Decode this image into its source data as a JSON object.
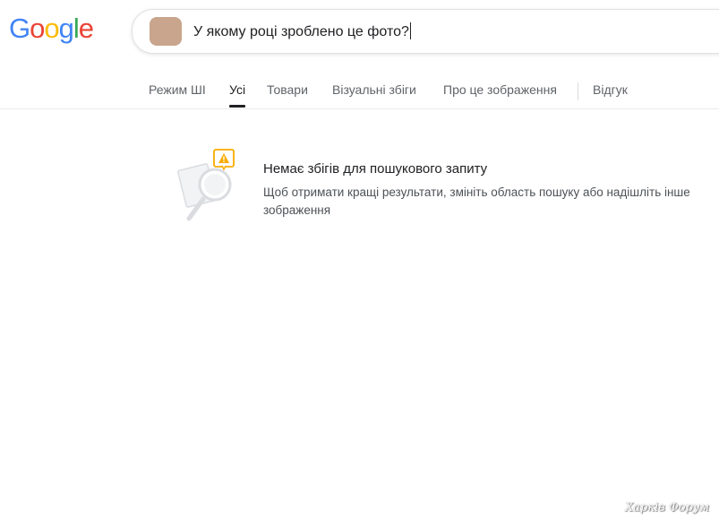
{
  "logo": {
    "letters": [
      "G",
      "o",
      "o",
      "g",
      "l",
      "e"
    ]
  },
  "search": {
    "query": "У якому році зроблено це фото?",
    "clear_symbol": "✕"
  },
  "tabs": [
    {
      "label": "Режим ШІ",
      "active": false
    },
    {
      "label": "Усі",
      "active": true
    },
    {
      "label": "Товари",
      "active": false
    },
    {
      "label": "Візуальні збіги",
      "active": false
    },
    {
      "label": "Про це зображення",
      "active": false
    },
    {
      "label": "Відгук",
      "active": false
    }
  ],
  "no_results": {
    "title": "Немає збігів для пошукового запиту",
    "description": "Щоб отримати кращі результати, змініть область пошуку або надішліть інше зображення",
    "illustration_icon": "magnifier-warning-icon",
    "warning_color": "#f9ab00"
  },
  "watermark": {
    "text": "Харків Форум"
  },
  "colors": {
    "logo_blue": "#4285f4",
    "logo_red": "#ea4335",
    "logo_yellow": "#fbbc05",
    "logo_green": "#34a853",
    "active_tab": "#202124",
    "inactive_tab": "#5f6368"
  }
}
